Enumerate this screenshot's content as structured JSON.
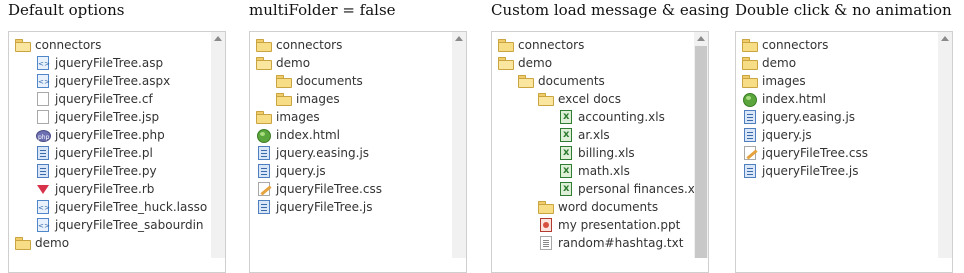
{
  "panels": [
    {
      "title": "Default options",
      "rows": [
        {
          "label": "connectors",
          "icon": "folder-open-icon",
          "depth": 0
        },
        {
          "label": "jqueryFileTree.asp",
          "icon": "code-file-icon",
          "depth": 1
        },
        {
          "label": "jqueryFileTree.aspx",
          "icon": "code-file-icon",
          "depth": 1
        },
        {
          "label": "jqueryFileTree.cf",
          "icon": "blank-file-icon",
          "depth": 1
        },
        {
          "label": "jqueryFileTree.jsp",
          "icon": "blank-file-icon",
          "depth": 1
        },
        {
          "label": "jqueryFileTree.php",
          "icon": "php-file-icon",
          "depth": 1
        },
        {
          "label": "jqueryFileTree.pl",
          "icon": "script-file-icon",
          "depth": 1
        },
        {
          "label": "jqueryFileTree.py",
          "icon": "script-file-icon",
          "depth": 1
        },
        {
          "label": "jqueryFileTree.rb",
          "icon": "ruby-file-icon",
          "depth": 1
        },
        {
          "label": "jqueryFileTree_huck.lasso",
          "icon": "code-file-icon",
          "depth": 1
        },
        {
          "label": "jqueryFileTree_sabourdin",
          "icon": "code-file-icon",
          "depth": 1
        },
        {
          "label": "demo",
          "icon": "folder-icon",
          "depth": 0
        }
      ],
      "scrollbar": {
        "up_arrow": "scroll-up-icon"
      }
    },
    {
      "title": "multiFolder = false",
      "rows": [
        {
          "label": "connectors",
          "icon": "folder-icon",
          "depth": 0
        },
        {
          "label": "demo",
          "icon": "folder-open-icon",
          "depth": 0
        },
        {
          "label": "documents",
          "icon": "folder-icon",
          "depth": 1
        },
        {
          "label": "images",
          "icon": "folder-icon",
          "depth": 1
        },
        {
          "label": "images",
          "icon": "folder-icon",
          "depth": 0
        },
        {
          "label": "index.html",
          "icon": "html-file-icon",
          "depth": 0
        },
        {
          "label": "jquery.easing.js",
          "icon": "script-file-icon",
          "depth": 0
        },
        {
          "label": "jquery.js",
          "icon": "script-file-icon",
          "depth": 0
        },
        {
          "label": "jqueryFileTree.css",
          "icon": "css-file-icon",
          "depth": 0
        },
        {
          "label": "jqueryFileTree.js",
          "icon": "script-file-icon",
          "depth": 0
        }
      ],
      "scrollbar": {
        "up_arrow": "scroll-up-icon"
      }
    },
    {
      "title": "Custom load message & easing",
      "rows": [
        {
          "label": "connectors",
          "icon": "folder-icon",
          "depth": 0
        },
        {
          "label": "demo",
          "icon": "folder-open-icon",
          "depth": 0
        },
        {
          "label": "documents",
          "icon": "folder-open-icon",
          "depth": 1
        },
        {
          "label": "excel docs",
          "icon": "folder-open-icon",
          "depth": 2
        },
        {
          "label": "accounting.xls",
          "icon": "xls-file-icon",
          "depth": 3
        },
        {
          "label": "ar.xls",
          "icon": "xls-file-icon",
          "depth": 3
        },
        {
          "label": "billing.xls",
          "icon": "xls-file-icon",
          "depth": 3
        },
        {
          "label": "math.xls",
          "icon": "xls-file-icon",
          "depth": 3
        },
        {
          "label": "personal finances.xls",
          "icon": "xls-file-icon",
          "depth": 3
        },
        {
          "label": "word documents",
          "icon": "folder-icon",
          "depth": 2
        },
        {
          "label": "my presentation.ppt",
          "icon": "ppt-file-icon",
          "depth": 2
        },
        {
          "label": "random#hashtag.txt",
          "icon": "txt-file-icon",
          "depth": 2
        }
      ],
      "scrollbar": {
        "up_arrow": "scroll-up-icon",
        "thumb": "scroll-thumb"
      }
    },
    {
      "title": "Double click & no animation",
      "rows": [
        {
          "label": "connectors",
          "icon": "folder-icon",
          "depth": 0
        },
        {
          "label": "demo",
          "icon": "folder-icon",
          "depth": 0
        },
        {
          "label": "images",
          "icon": "folder-icon",
          "depth": 0
        },
        {
          "label": "index.html",
          "icon": "html-file-icon",
          "depth": 0
        },
        {
          "label": "jquery.easing.js",
          "icon": "script-file-icon",
          "depth": 0
        },
        {
          "label": "jquery.js",
          "icon": "script-file-icon",
          "depth": 0
        },
        {
          "label": "jqueryFileTree.css",
          "icon": "css-file-icon",
          "depth": 0
        },
        {
          "label": "jqueryFileTree.js",
          "icon": "script-file-icon",
          "depth": 0
        }
      ],
      "scrollbar": {
        "up_arrow": "scroll-up-icon"
      }
    }
  ]
}
